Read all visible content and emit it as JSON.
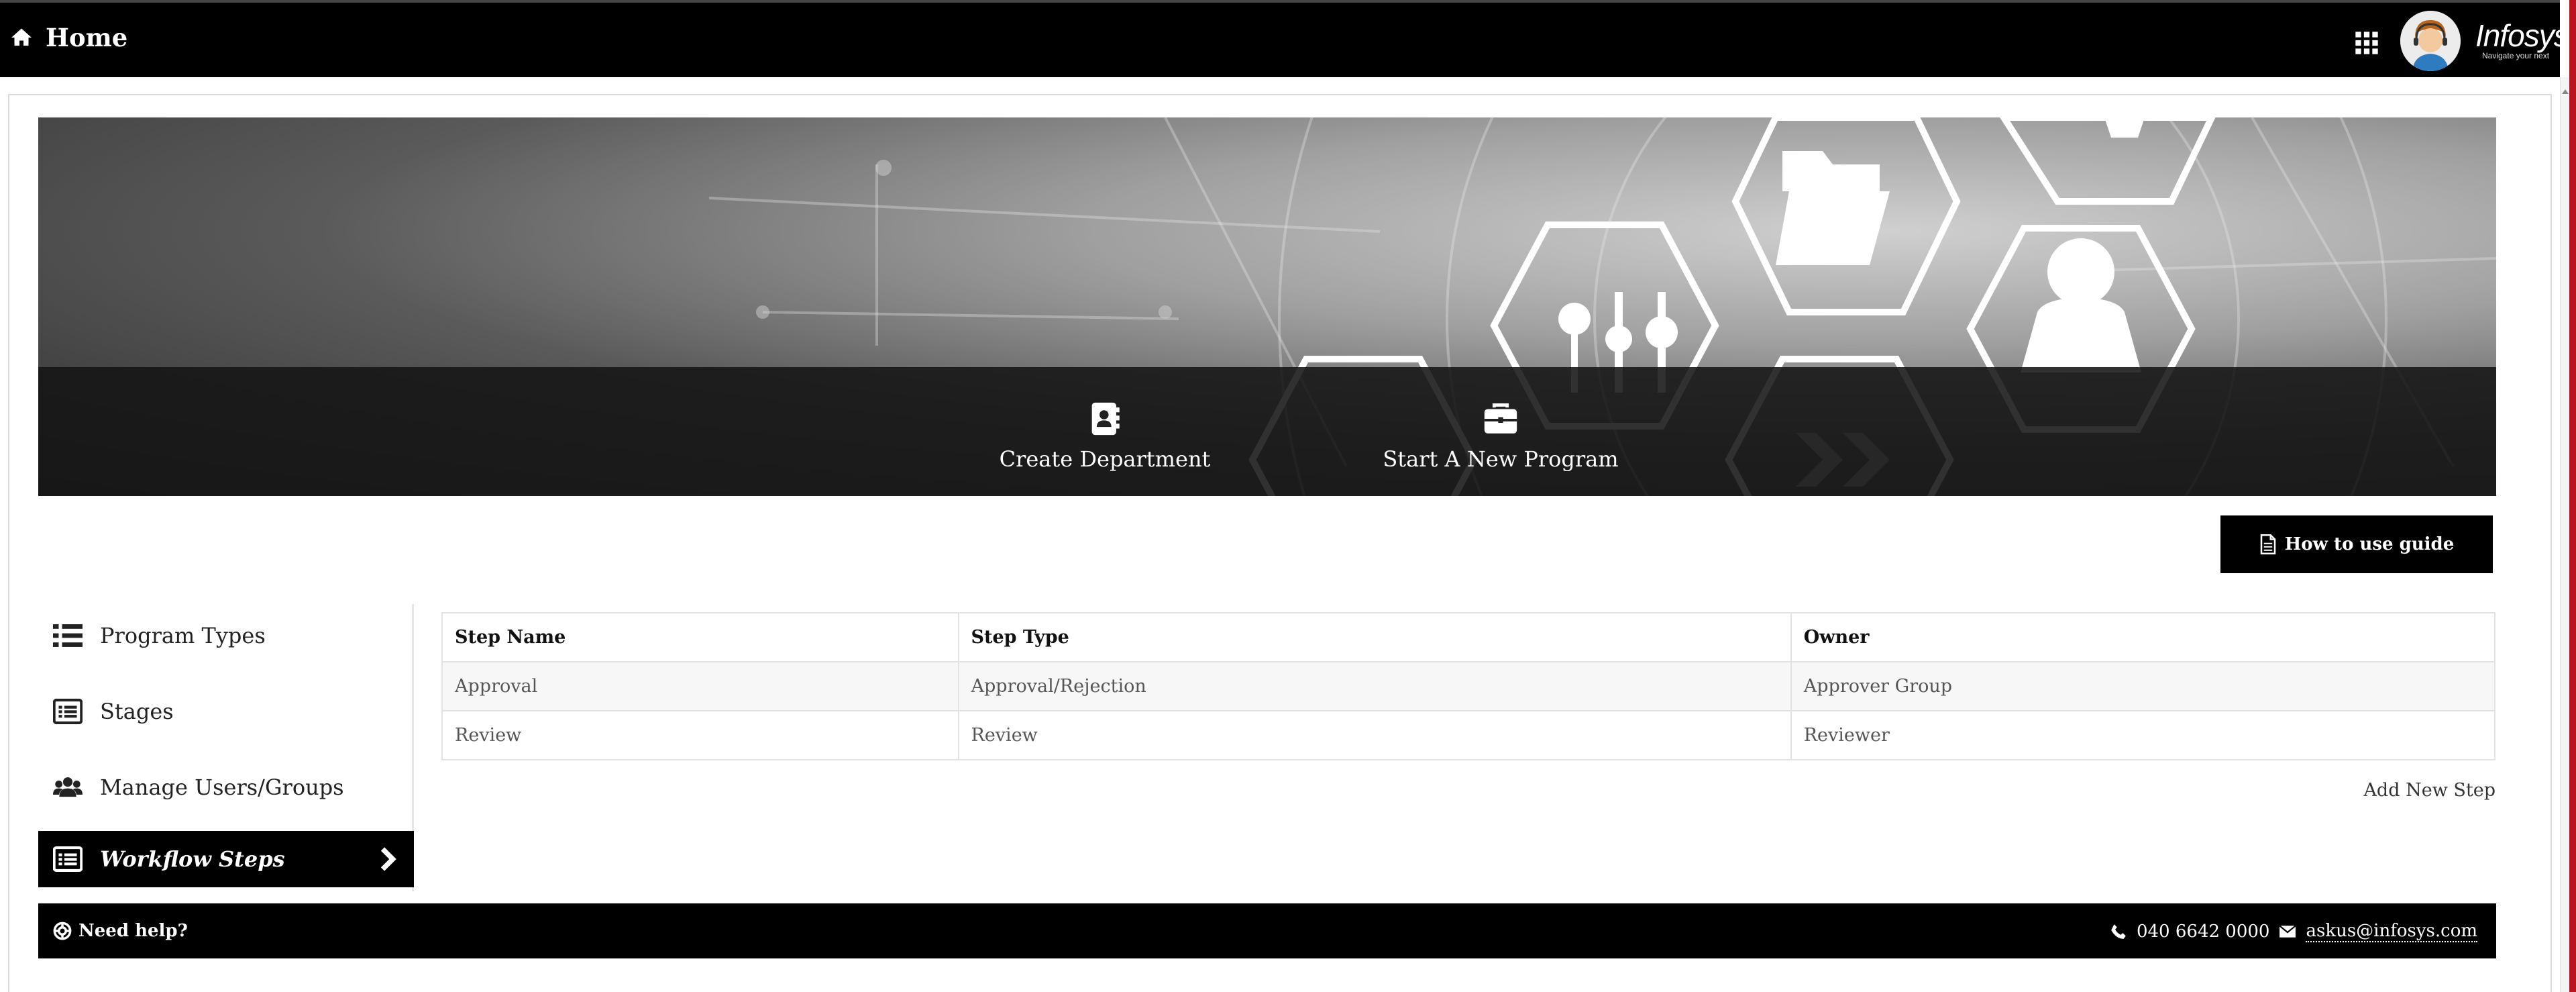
{
  "header": {
    "title": "Home",
    "logo_text": "Infosys",
    "logo_tagline": "Navigate your next"
  },
  "banner": {
    "actions": [
      {
        "label": "Create Department",
        "icon": "address-book-icon"
      },
      {
        "label": "Start A New Program",
        "icon": "briefcase-icon"
      }
    ]
  },
  "guide_button": {
    "label": "How to use guide",
    "icon": "document-icon"
  },
  "sidebar": {
    "items": [
      {
        "label": "Program Types",
        "icon": "list-icon"
      },
      {
        "label": "Stages",
        "icon": "list-alt-icon"
      },
      {
        "label": "Manage Users/Groups",
        "icon": "users-icon"
      },
      {
        "label": "Workflow Steps",
        "icon": "list-alt-icon",
        "active": true
      }
    ]
  },
  "table": {
    "columns": [
      "Step Name",
      "Step Type",
      "Owner"
    ],
    "rows": [
      [
        "Approval",
        "Approval/Rejection",
        "Approver Group"
      ],
      [
        "Review",
        "Review",
        "Reviewer"
      ]
    ],
    "add_label": "Add New Step"
  },
  "footer": {
    "help": "Need help?",
    "phone": "040 6642 0000",
    "email": "askus@infosys.com"
  }
}
